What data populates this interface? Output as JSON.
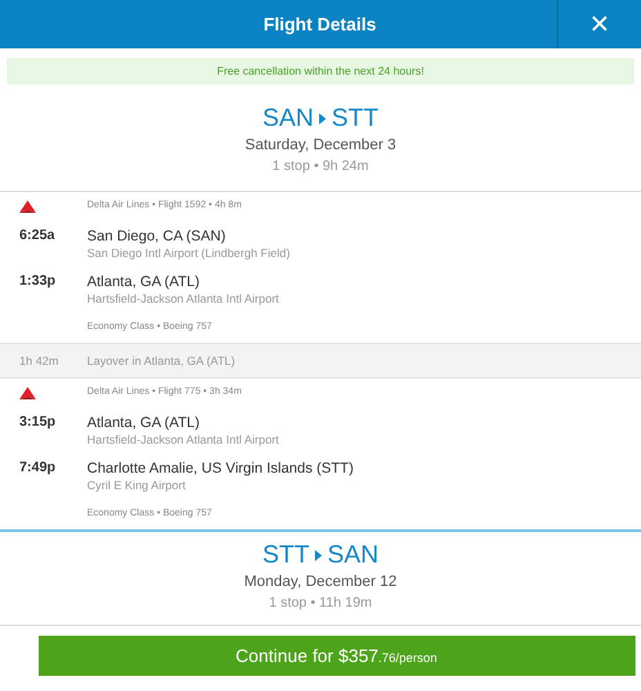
{
  "window": {
    "title": "Flight Details",
    "close": "×"
  },
  "banner": "Free cancellation within the next 24 hours!",
  "legs": [
    {
      "from": "SAN",
      "to": "STT",
      "date": "Saturday, December 3",
      "summary": "1 stop • 9h 24m",
      "expanded": true,
      "items": [
        {
          "kind": "segment",
          "info": "Delta Air Lines • Flight 1592 • 4h 8m",
          "stops": [
            {
              "time": "6:25a",
              "city": "San Diego, CA (SAN)",
              "airport": "San Diego Intl Airport (Lindbergh Field)"
            },
            {
              "time": "1:33p",
              "city": "Atlanta, GA (ATL)",
              "airport": "Hartsfield-Jackson Atlanta Intl Airport"
            }
          ],
          "cabin": "Economy Class • Boeing 757"
        },
        {
          "kind": "layover",
          "duration": "1h 42m",
          "text": "Layover in Atlanta, GA (ATL)"
        },
        {
          "kind": "segment",
          "info": "Delta Air Lines • Flight 775 • 3h 34m",
          "stops": [
            {
              "time": "3:15p",
              "city": "Atlanta, GA (ATL)",
              "airport": "Hartsfield-Jackson Atlanta Intl Airport"
            },
            {
              "time": "7:49p",
              "city": "Charlotte Amalie, US Virgin Islands (STT)",
              "airport": "Cyril E King Airport"
            }
          ],
          "cabin": "Economy Class • Boeing 757"
        }
      ]
    },
    {
      "from": "STT",
      "to": "SAN",
      "date": "Monday, December 12",
      "summary": "1 stop • 11h 19m",
      "expanded": false
    }
  ],
  "continue_button": {
    "label": "Continue for $357",
    "suffix": ".76/person"
  }
}
